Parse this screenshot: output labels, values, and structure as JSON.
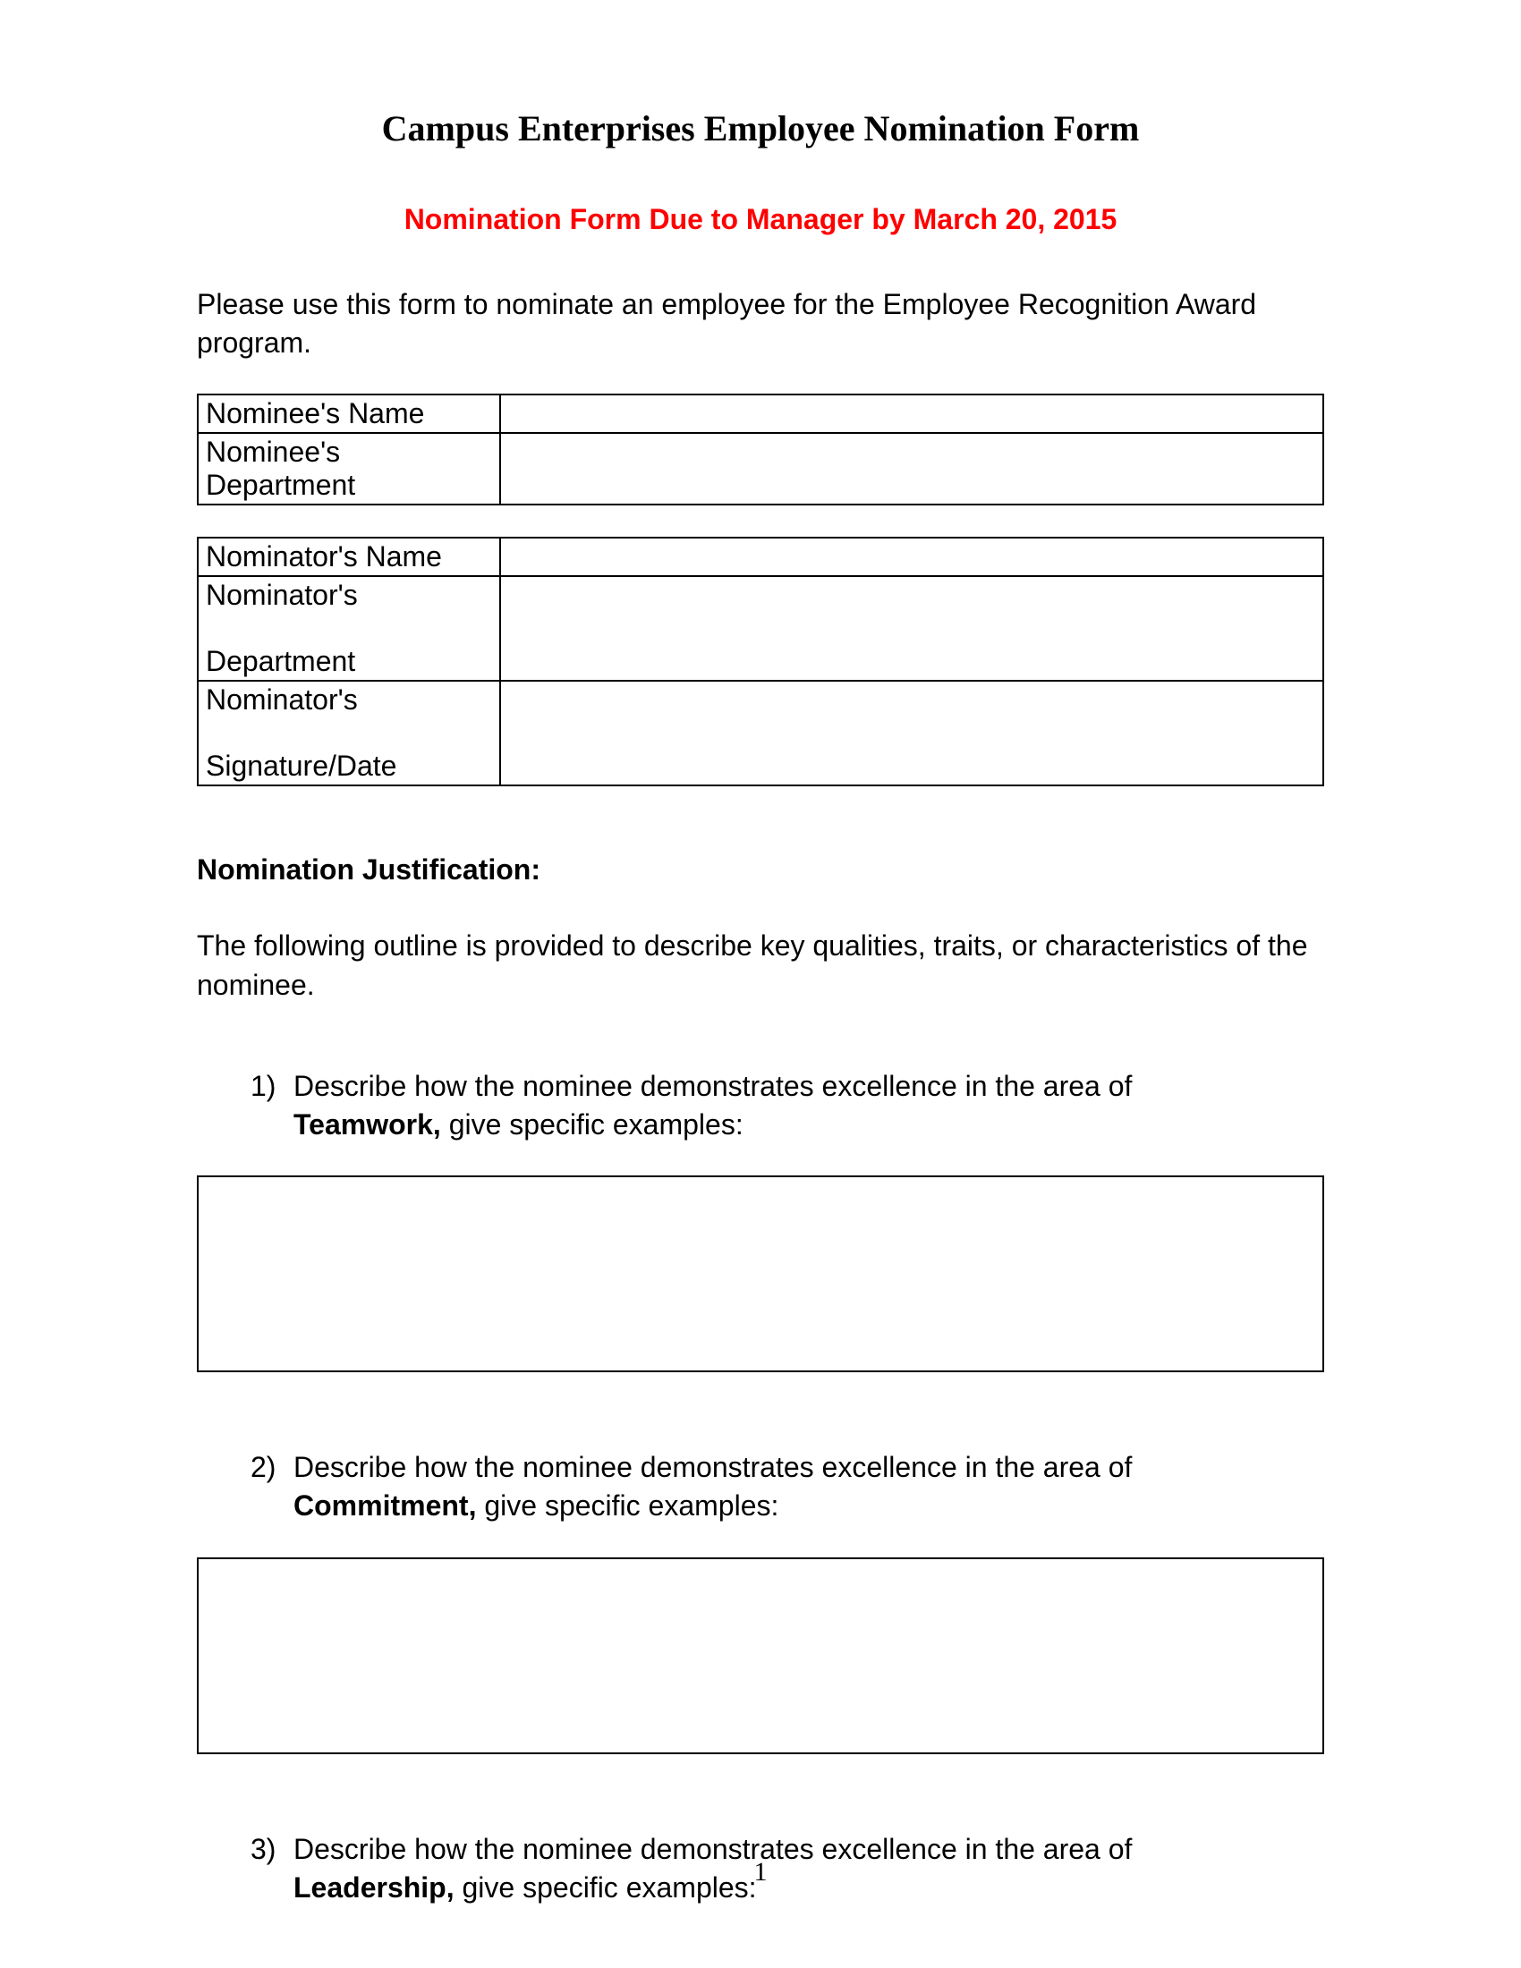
{
  "title": "Campus Enterprises Employee Nomination Form",
  "due_line": "Nomination Form Due to Manager by March 20, 2015",
  "intro": "Please use this form to nominate an employee for the Employee Recognition Award program.",
  "nominee_table": {
    "name_label": "Nominee's Name",
    "dept_label": "Nominee's Department",
    "name_value": "",
    "dept_value": ""
  },
  "nominator_table": {
    "name_label": "Nominator's Name",
    "dept_label_line1": "Nominator's",
    "dept_label_line2": "Department",
    "sig_label_line1": "Nominator's",
    "sig_label_line2": "Signature/Date",
    "name_value": "",
    "dept_value": "",
    "sig_value": ""
  },
  "justification_heading": "Nomination Justification:",
  "justification_desc": "The following outline is provided to describe key qualities, traits, or characteristics of the nominee.",
  "questions": {
    "q1_num": "1)",
    "q1_pre": "Describe  how the nominee demonstrates excellence  in the area of ",
    "q1_bold": "Teamwork,",
    "q1_post": "  give specific examples:",
    "q2_num": "2)",
    "q2_pre": "Describe  how the nominee demonstrates excellence  in the area of ",
    "q2_bold": "Commitment,",
    "q2_post": " give specific examples:",
    "q3_num": "3)",
    "q3_pre": "Describe  how the nominee demonstrates excellence in the area of ",
    "q3_bold": "Leadership,",
    "q3_post": " give specific examples:"
  },
  "page_number": "1"
}
